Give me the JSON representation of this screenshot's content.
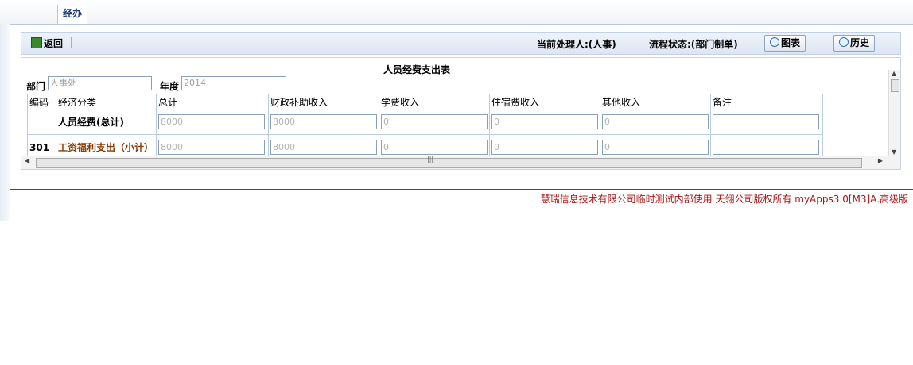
{
  "tab": {
    "label": "经办"
  },
  "toolbar": {
    "back_label": "返回",
    "handler": "当前处理人:(人事)",
    "flow_status": "流程状态:(部门制单)",
    "chart_button": "图表",
    "history_button": "历史"
  },
  "form": {
    "title": "人员经费支出表",
    "dept_label": "部门",
    "dept_value": "人事处",
    "year_label": "年度",
    "year_value": "2014",
    "headers": [
      "编码",
      "经济分类",
      "总计",
      "财政补助收入",
      "学费收入",
      "住宿费收入",
      "其他收入",
      "备注"
    ],
    "rows": [
      {
        "code": "",
        "category": "人员经费(总计)",
        "values": [
          "8000",
          "8000",
          "0",
          "0",
          "0",
          ""
        ]
      },
      {
        "code": "301",
        "category": "工资福利支出（小计）",
        "values": [
          "8000",
          "8000",
          "0",
          "0",
          "0",
          ""
        ]
      }
    ]
  },
  "footer": {
    "text": "慧瑞信息技术有限公司临时测试内部使用  天翎公司版权所有  myApps3.0[M3]A.高级版"
  }
}
